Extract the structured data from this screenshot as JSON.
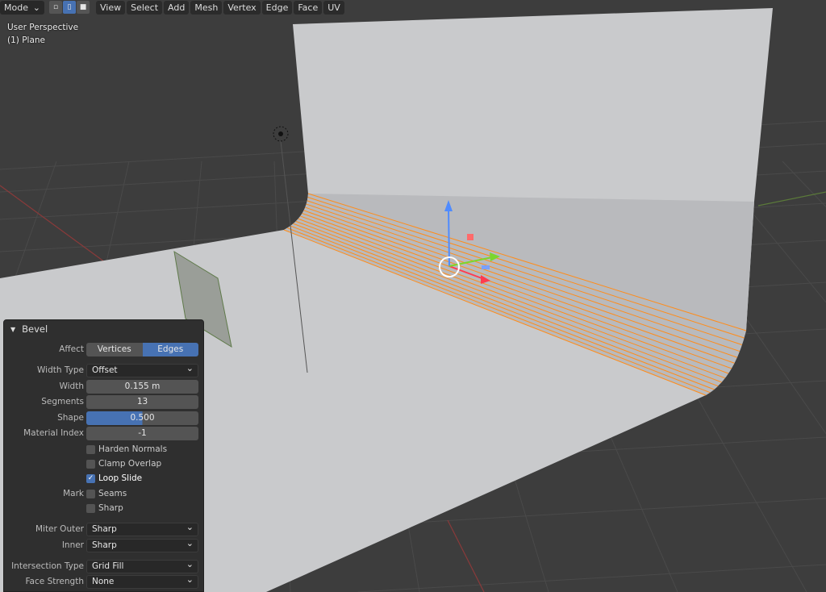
{
  "header": {
    "mode": "Mode",
    "menus": [
      "View",
      "Select",
      "Add",
      "Mesh",
      "Vertex",
      "Edge",
      "Face",
      "UV"
    ]
  },
  "overlay": {
    "view": "User Perspective",
    "object": "(1) Plane"
  },
  "bevel": {
    "title": "Bevel",
    "affect": {
      "label": "Affect",
      "options": [
        "Vertices",
        "Edges"
      ],
      "selected": "Edges"
    },
    "width_type": {
      "label": "Width Type",
      "value": "Offset"
    },
    "width": {
      "label": "Width",
      "value": "0.155 m"
    },
    "segments": {
      "label": "Segments",
      "value": "13"
    },
    "shape": {
      "label": "Shape",
      "value": "0.500",
      "fraction": 0.5
    },
    "material_index": {
      "label": "Material Index",
      "value": "-1"
    },
    "harden_normals": {
      "label": "Harden Normals",
      "checked": false
    },
    "clamp_overlap": {
      "label": "Clamp Overlap",
      "checked": false
    },
    "loop_slide": {
      "label": "Loop Slide",
      "checked": true
    },
    "mark": {
      "label": "Mark",
      "seams": "Seams",
      "sharp": "Sharp"
    },
    "miter_outer": {
      "label": "Miter Outer",
      "value": "Sharp"
    },
    "inner": {
      "label": "Inner",
      "value": "Sharp"
    },
    "intersection_type": {
      "label": "Intersection Type",
      "value": "Grid Fill"
    },
    "face_strength": {
      "label": "Face Strength",
      "value": "None"
    }
  },
  "colors": {
    "accent": "#4772b3",
    "edge": "#ff8c1a"
  }
}
